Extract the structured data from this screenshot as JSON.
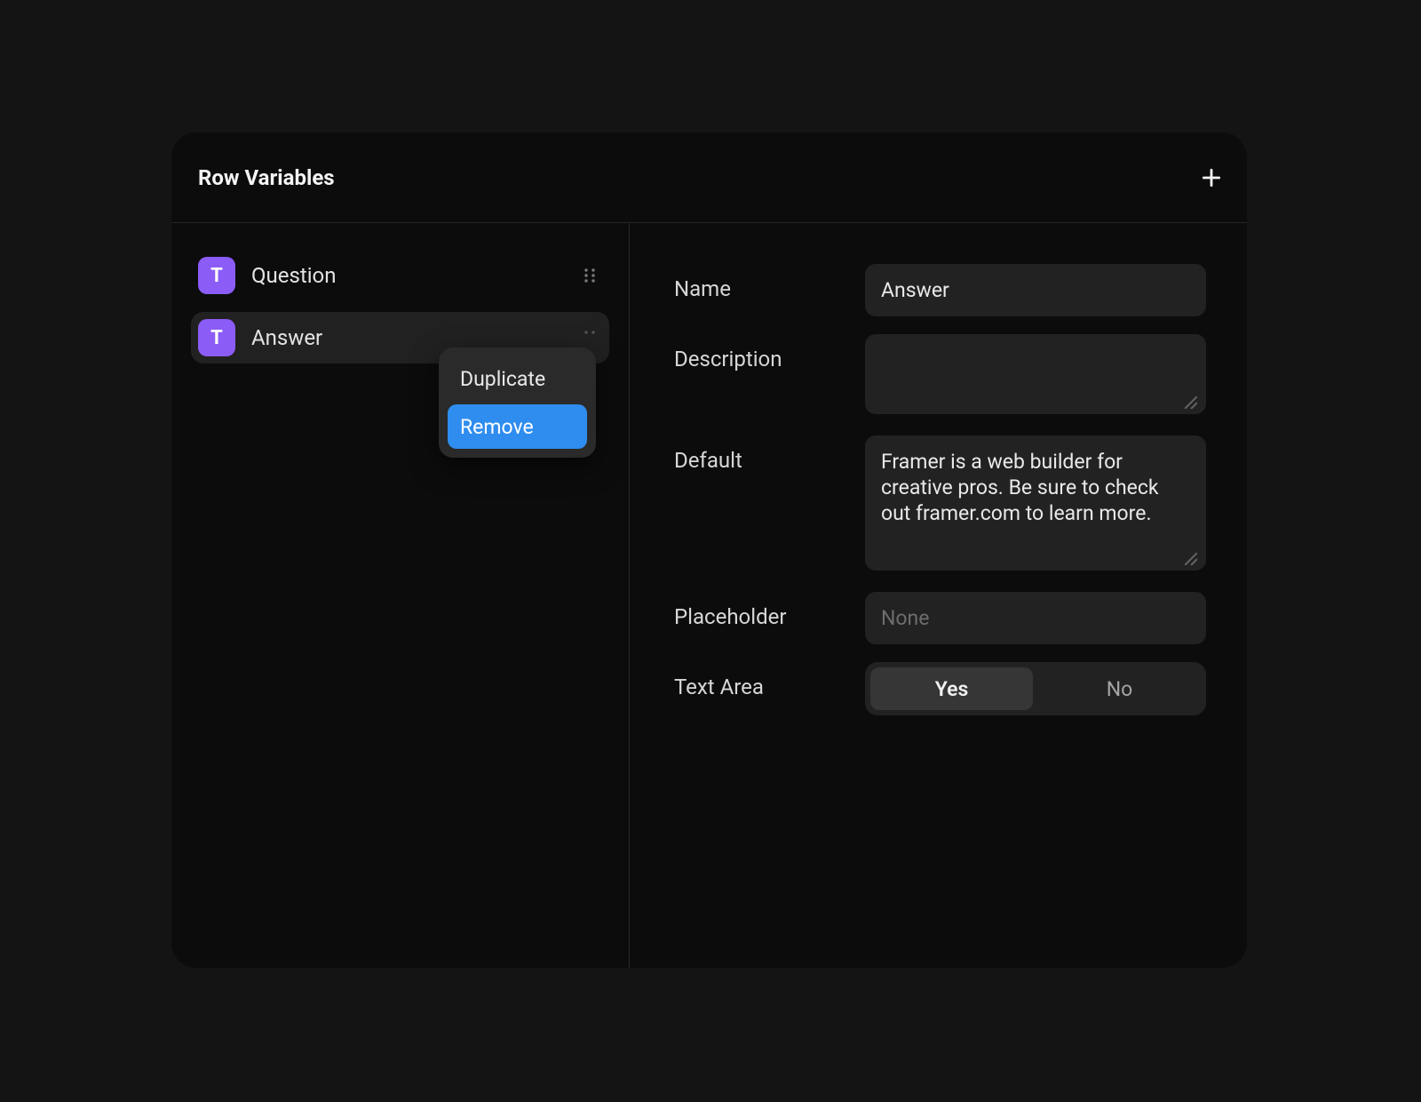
{
  "header": {
    "title": "Row Variables",
    "addIcon": "plus-icon"
  },
  "variables": [
    {
      "badge": "T",
      "label": "Question",
      "selected": false
    },
    {
      "badge": "T",
      "label": "Answer",
      "selected": true
    }
  ],
  "contextMenu": {
    "items": [
      {
        "label": "Duplicate",
        "highlight": false
      },
      {
        "label": "Remove",
        "highlight": true
      }
    ]
  },
  "form": {
    "fields": {
      "name": {
        "label": "Name",
        "value": "Answer"
      },
      "description": {
        "label": "Description",
        "value": ""
      },
      "default": {
        "label": "Default",
        "value": "Framer is a web builder for creative pros. Be sure to check out framer.com to learn more."
      },
      "placeholder": {
        "label": "Placeholder",
        "value": "",
        "placeholder": "None"
      },
      "textArea": {
        "label": "Text Area",
        "options": [
          "Yes",
          "No"
        ],
        "selected": "Yes"
      }
    }
  },
  "colors": {
    "accentPurple": "#8b5cf6",
    "accentBlue": "#2f8def",
    "panelBg": "#0c0c0c",
    "inputBg": "#222222"
  }
}
